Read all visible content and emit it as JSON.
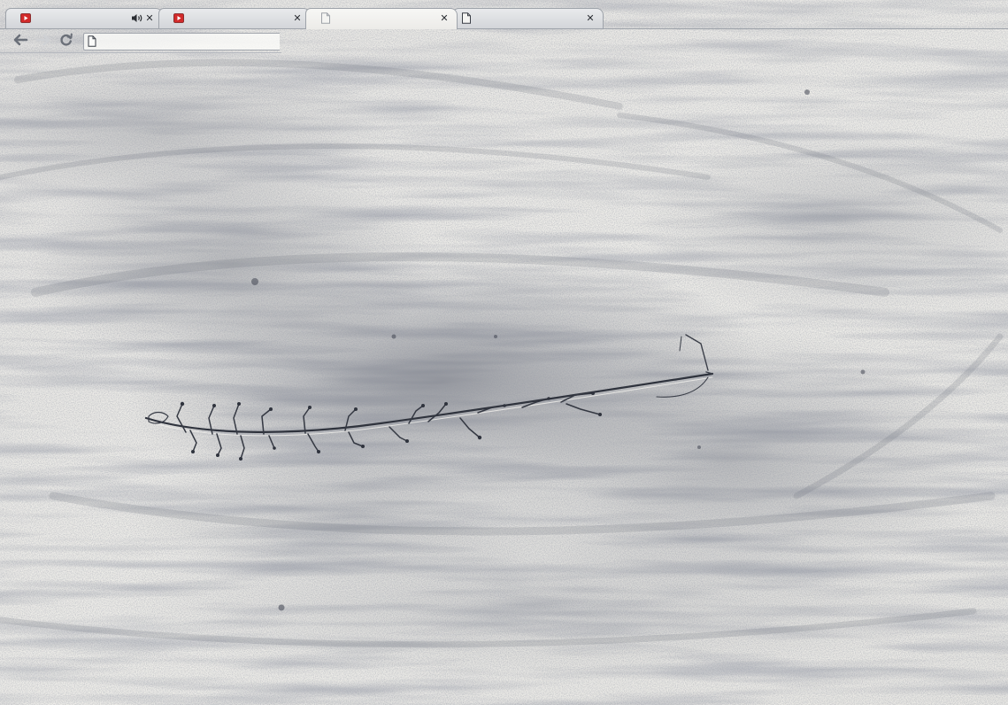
{
  "tabs": [
    {
      "title": "",
      "favicon": "youtube-icon",
      "audio": true,
      "active": false
    },
    {
      "title": "",
      "favicon": "youtube-icon",
      "audio": false,
      "active": false
    },
    {
      "title": "",
      "favicon": "page-icon",
      "audio": false,
      "active": true
    },
    {
      "title": "",
      "favicon": "page-icon",
      "audio": false,
      "active": false
    }
  ],
  "icons": {
    "close": "✕",
    "back": "arrow-left-icon",
    "forward": "arrow-right-icon",
    "reload": "reload-icon",
    "audio": "speaker-icon",
    "omnibox_page": "page-icon"
  },
  "omnibox": {
    "value": "",
    "placeholder": ""
  },
  "colors": {
    "paper": "#ebeae6",
    "graphite": "#4a4f5c",
    "tab_border": "#9ea3aa",
    "favicon_red": "#d22a2a"
  }
}
